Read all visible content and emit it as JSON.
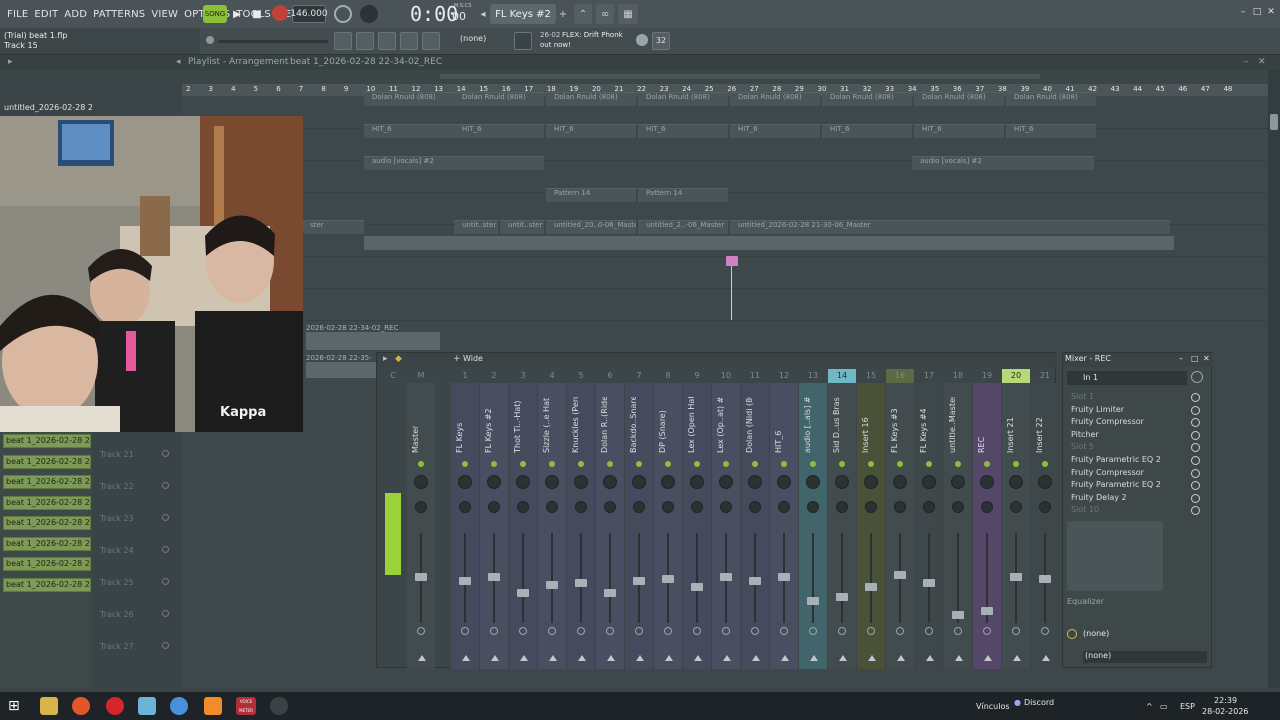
{
  "menu": {
    "items": [
      "FILE",
      "EDIT",
      "ADD",
      "PATTERNS",
      "VIEW",
      "OPTIONS",
      "TOOLS",
      "HELP"
    ]
  },
  "transport": {
    "mode": "SONG",
    "tempo": "146.000",
    "time": "0:00",
    "time_sub": "00",
    "time_label": "M:S:CS",
    "pattern": "FL Keys #2"
  },
  "hint": {
    "file": "(Trial) beat 1.flp",
    "track": "Track 15"
  },
  "toolbar2": {
    "snap": "(none)",
    "news_date": "26-02",
    "news_title": "FLEX: Drift Phonk",
    "news_sub": "out now!",
    "pattern_count": "32"
  },
  "playlist": {
    "title": "Playlist - Arrangement",
    "breadcrumb": "beat 1_2026-02-28 22-34-02_REC",
    "ruler": [
      "2",
      "3",
      "4",
      "5",
      "6",
      "7",
      "8",
      "9",
      "10",
      "11",
      "12",
      "13",
      "14",
      "15",
      "16",
      "17",
      "18",
      "19",
      "20",
      "21",
      "22",
      "23",
      "24",
      "25",
      "26",
      "27",
      "28",
      "29",
      "30",
      "31",
      "32",
      "33",
      "34",
      "35",
      "36",
      "37",
      "38",
      "39",
      "40",
      "41",
      "42",
      "43",
      "44",
      "45",
      "46",
      "47",
      "48"
    ],
    "clips_row1": [
      "Dolan Rnuld (808)",
      "Dolan Rnuld (808)",
      "Dolan Rnuld (808)",
      "Dolan Rnuld (808)",
      "Dolan Rnuld (808)",
      "Dolan Rnuld (808)",
      "Dolan Rnuld (808)",
      "Dolan Rnuld (808)"
    ],
    "clips_row2": [
      "HIT_6",
      "HIT_6",
      "HIT_6",
      "HIT_6",
      "HIT_6",
      "HIT_6",
      "HIT_6",
      "HIT_6"
    ],
    "clips_row3": [
      "audio [vocals] #2",
      "audio [vocals] #2"
    ],
    "clips_row4": [
      "Pattern 14",
      "Pattern 14"
    ],
    "clips_row5": [
      "ster",
      "untit..ster",
      "untit..ster",
      "untitled_20..0-06_Master",
      "untitled_2..-06_Master",
      "untitled_2026-02-28 21-30-06_Master"
    ],
    "rec_clip": "2026-02-28 22-34-02_REC",
    "rec_clip2": "2026-02-28 22-35-",
    "webcam_label": "untitled_2026-02-28 21-"
  },
  "tracks": [
    "Track 21",
    "Track 22",
    "Track 23",
    "Track 24",
    "Track 25",
    "Track 26",
    "Track 27"
  ],
  "browser": [
    "beat 1_2026-02-28 22-2",
    "beat 1_2026-02-28 22-3",
    "beat 1_2026-02-28 22-3",
    "beat 1_2026-02-28 22-3",
    "beat 1_2026-02-28 22-3",
    "beat 1_2026-02-28 22-3",
    "beat 1_2026-02-28 22-3",
    "beat 1_2026-02-28 22-3"
  ],
  "mixer": {
    "view": "Wide",
    "numbers": [
      "C",
      "M",
      "1",
      "2",
      "3",
      "4",
      "5",
      "6",
      "7",
      "8",
      "9",
      "10",
      "11",
      "12",
      "13",
      "14",
      "15",
      "16",
      "17",
      "18",
      "19",
      "20",
      "21",
      "22"
    ],
    "strips": [
      "Master",
      "FL Keys",
      "FL Keys #2",
      "Thot Ti..-Hat)",
      "Sizzle (..e Hat)",
      "Knuckles (Perc)",
      "Dolan R..(Ride)",
      "Backdo..Snare)",
      "DP (Snare)",
      "Lex (Open Hat)",
      "Lex (Op..at) #2",
      "Dolan (Nidi (808)",
      "HIT_6",
      "audio [..als] #2",
      "Sid D..us Brass",
      "Insert 16",
      "FL Keys #3",
      "FL Keys #4",
      "untitle..Master",
      "REC",
      "Insert 21",
      "Insert 22"
    ]
  },
  "fx": {
    "title": "Mixer - REC",
    "input": "In 1",
    "slots": [
      "Slot 1",
      "Fruity Limiter",
      "Fruity Compressor",
      "Pitcher",
      "Slot 5",
      "Fruity Parametric EQ 2",
      "Fruity Compressor",
      "Fruity Parametric EQ 2",
      "Fruity Delay 2",
      "Slot 10"
    ],
    "eq_label": "Equalizer",
    "out1": "(none)",
    "out2": "(none)"
  },
  "taskbar": {
    "links": "Vínculos",
    "discord": "Discord",
    "lang": "ESP",
    "time": "22:39",
    "date": "28-02-2026",
    "overlay_app": "VOICE METER"
  },
  "colors": {
    "accent_green": "#8cbf3a",
    "highlight_teal": "#6fb9c6",
    "rec_green": "#b8d77a",
    "browser_green": "#7d9a58"
  }
}
